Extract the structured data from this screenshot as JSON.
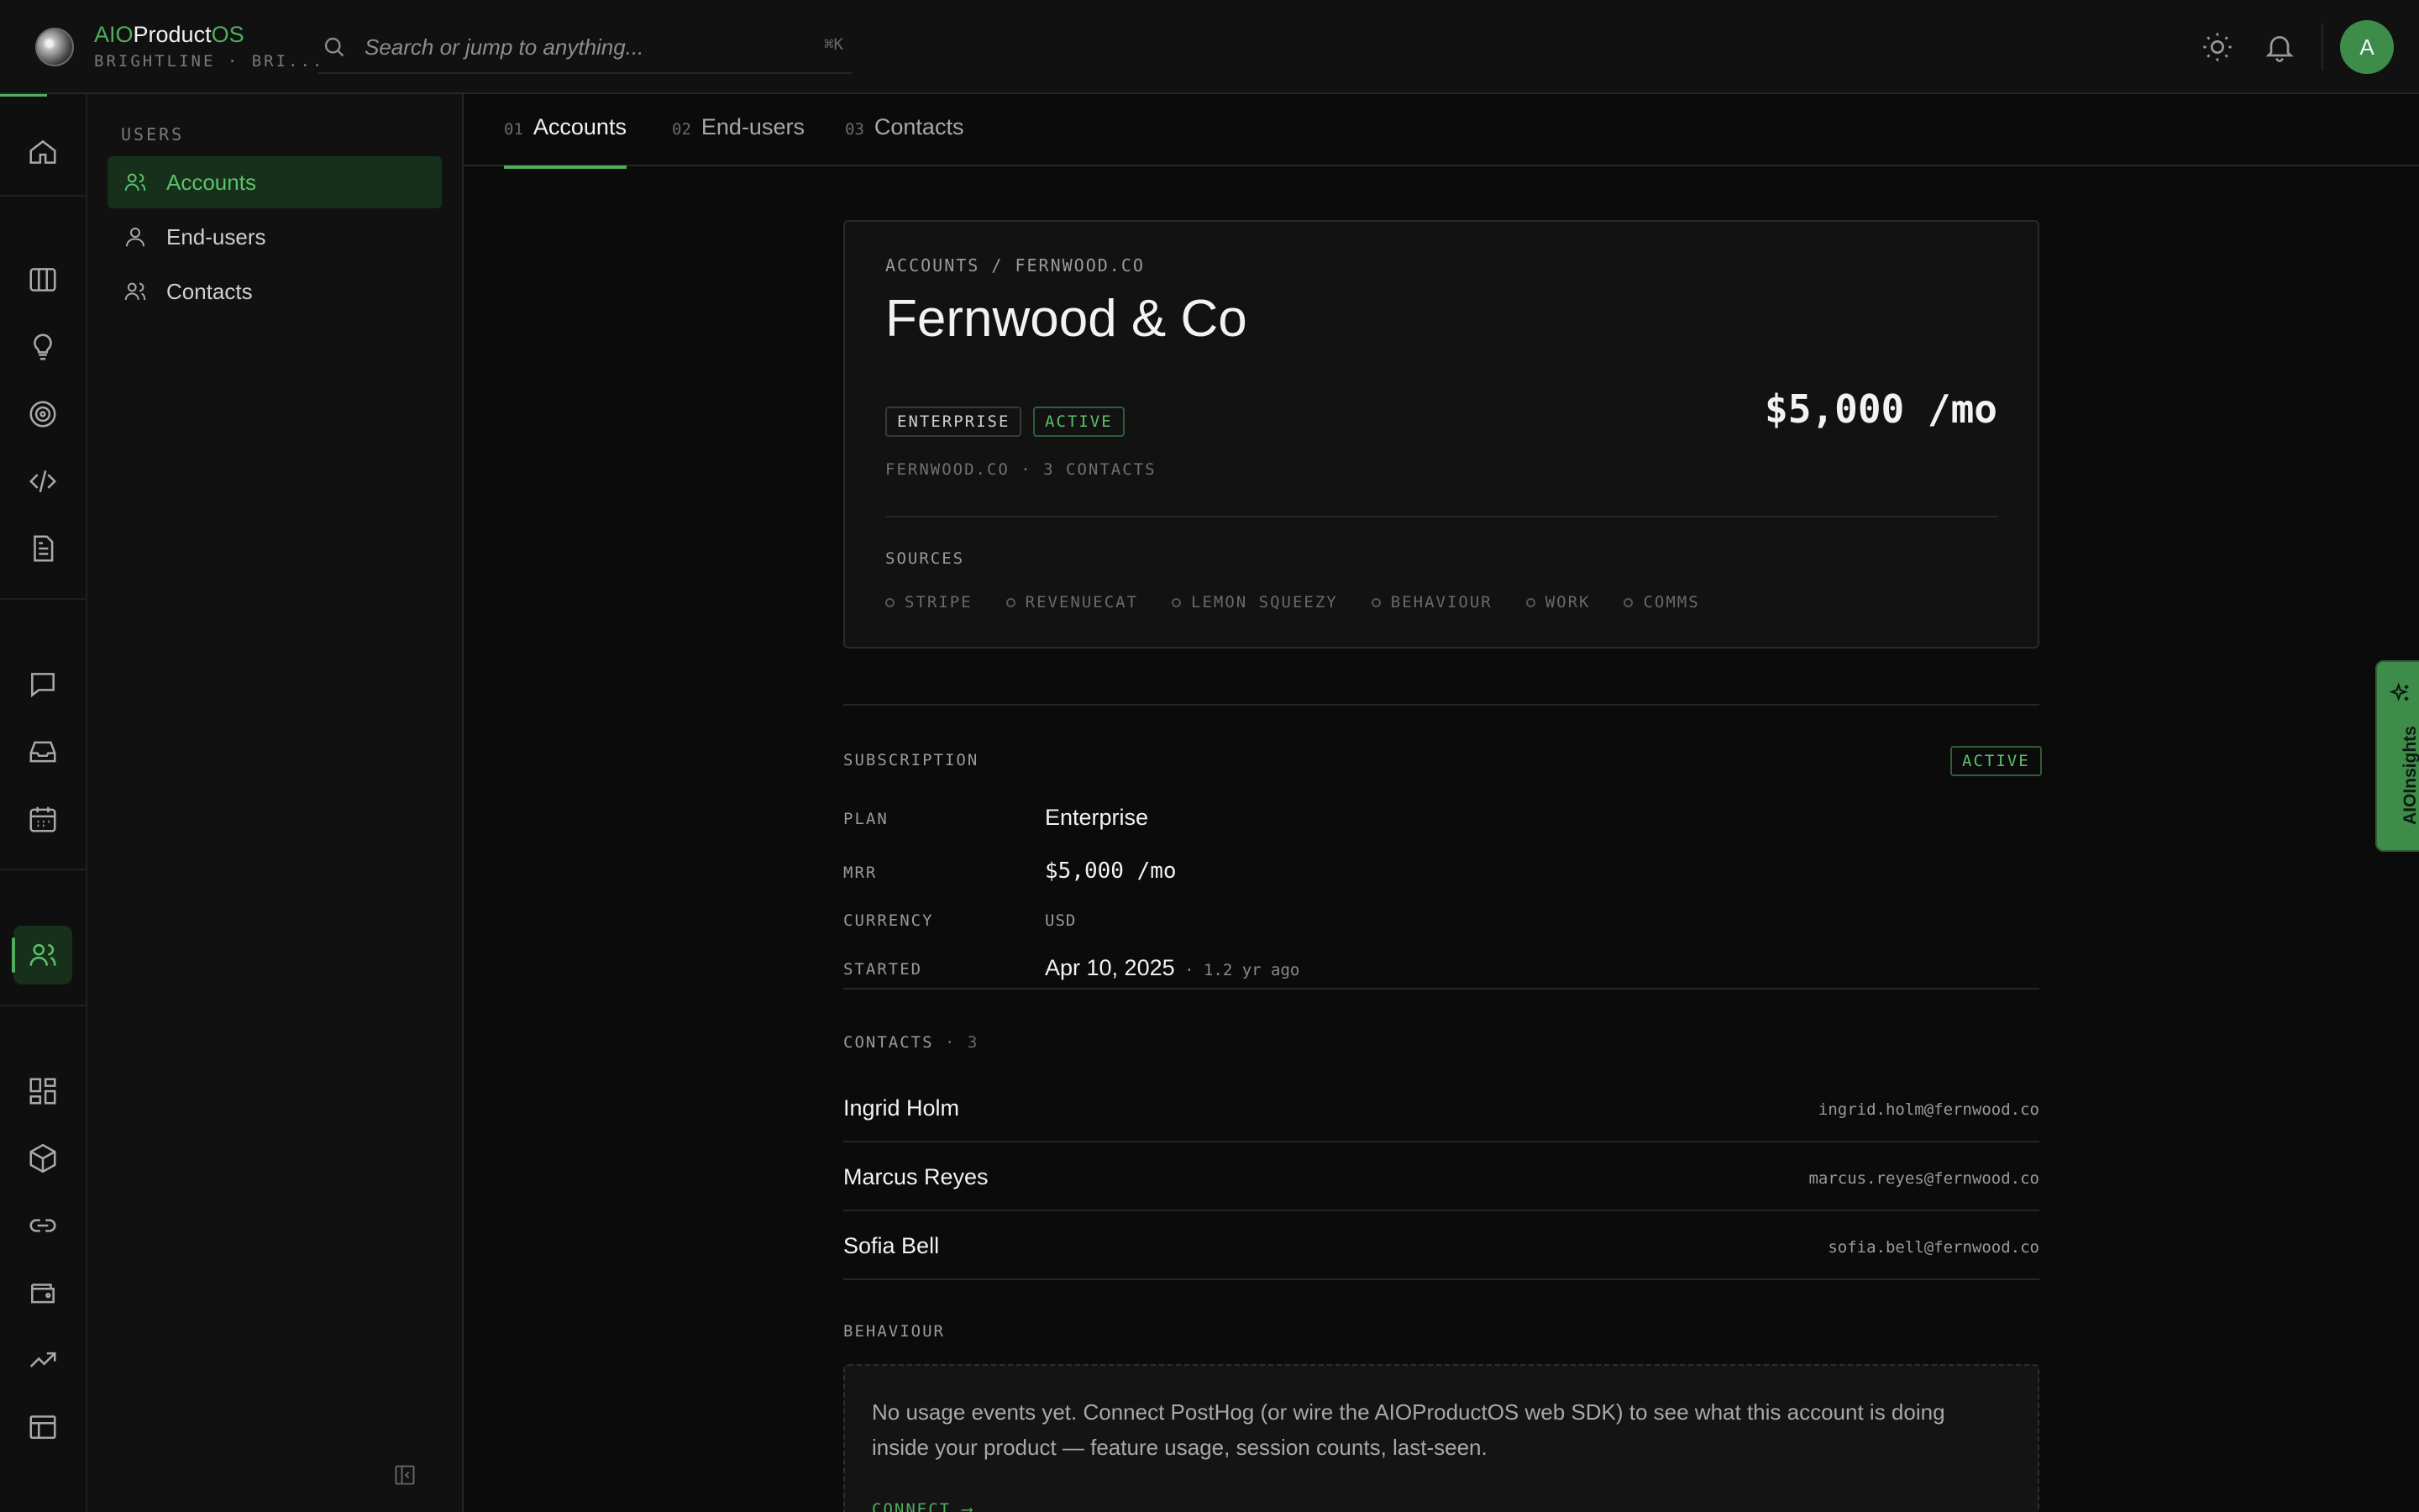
{
  "brand": {
    "prefix": "AIO",
    "name": "Product",
    "suffix": "OS",
    "workspace": "BRIGHTLINE · BRI..."
  },
  "search": {
    "placeholder": "Search or jump to anything...",
    "shortcut": "⌘K"
  },
  "user": {
    "initial": "A"
  },
  "sidebar": {
    "heading": "USERS",
    "items": [
      {
        "label": "Accounts",
        "icon": "users-icon",
        "active": true
      },
      {
        "label": "End-users",
        "icon": "user-icon",
        "active": false
      },
      {
        "label": "Contacts",
        "icon": "users-icon",
        "active": false
      }
    ]
  },
  "rail": {
    "items": [
      "home-icon",
      "board-icon",
      "lightbulb-icon",
      "target-icon",
      "code-icon",
      "document-icon",
      "chat-icon",
      "inbox-icon",
      "calendar-icon",
      "users-icon",
      "grid-icon",
      "cube-icon",
      "link-icon",
      "wallet-icon",
      "trending-icon",
      "table-icon"
    ]
  },
  "tabs": [
    {
      "num": "01",
      "label": "Accounts",
      "active": true
    },
    {
      "num": "02",
      "label": "End-users",
      "active": false
    },
    {
      "num": "03",
      "label": "Contacts",
      "active": false
    }
  ],
  "account": {
    "breadcrumb": "ACCOUNTS / FERNWOOD.CO",
    "name": "Fernwood & Co",
    "plan_badge": "ENTERPRISE",
    "status_badge": "ACTIVE",
    "mrr": "$5,000 /mo",
    "meta": "FERNWOOD.CO · 3 CONTACTS",
    "sources_heading": "SOURCES",
    "sources": [
      "STRIPE",
      "REVENUECAT",
      "LEMON SQUEEZY",
      "BEHAVIOUR",
      "WORK",
      "COMMS"
    ]
  },
  "subscription": {
    "heading": "SUBSCRIPTION",
    "status": "ACTIVE",
    "plan_label": "PLAN",
    "plan_value": "Enterprise",
    "mrr_label": "MRR",
    "mrr_value": "$5,000 /mo",
    "currency_label": "CURRENCY",
    "currency_value": "USD",
    "started_label": "STARTED",
    "started_value": "Apr 10, 2025",
    "started_ago": "1.2 yr ago"
  },
  "contacts": {
    "heading": "CONTACTS",
    "count": "3",
    "rows": [
      {
        "name": "Ingrid Holm",
        "email": "ingrid.holm@fernwood.co"
      },
      {
        "name": "Marcus Reyes",
        "email": "marcus.reyes@fernwood.co"
      },
      {
        "name": "Sofia Bell",
        "email": "sofia.bell@fernwood.co"
      }
    ]
  },
  "behaviour": {
    "heading": "BEHAVIOUR",
    "empty_text": "No usage events yet. Connect PostHog (or wire the AIOProductOS web SDK) to see what this account is doing inside your product — feature usage, session counts, last-seen.",
    "connect_label": "CONNECT ⟶"
  },
  "insights": {
    "label": "AIOInsights"
  },
  "colors": {
    "accent": "#4fae5c",
    "accent_bg": "#16301c",
    "background": "#0b0b0b",
    "panel": "#111111"
  }
}
